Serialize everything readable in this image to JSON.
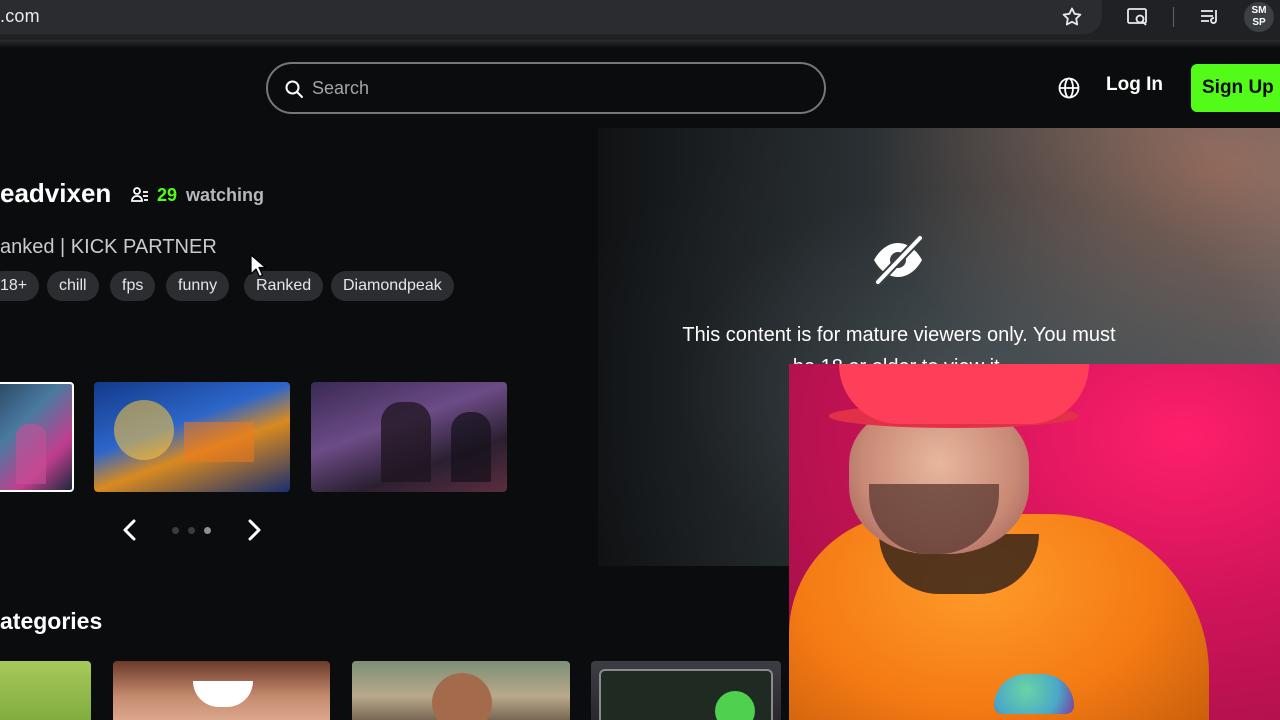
{
  "browser": {
    "url_fragment": ".com",
    "avatar_initials_top": "SM",
    "avatar_initials_bottom": "SP"
  },
  "header": {
    "search_placeholder": "Search",
    "login_label": "Log In",
    "signup_label": "Sign Up",
    "accent_color": "#53fc18"
  },
  "stream": {
    "channel_name": "eadvixen",
    "viewer_count": "29",
    "viewer_label": "watching",
    "title": "anked | KICK PARTNER",
    "tags": [
      "18+",
      "chill",
      "fps",
      "funny",
      "Ranked",
      "Diamondpeak"
    ]
  },
  "carousel": {
    "active_dot": 2,
    "dot_count": 3
  },
  "player": {
    "mature_line1": "This content is for mature viewers only. You must",
    "mature_line2": "be 18 or older to view it."
  },
  "categories": {
    "heading": "ategories"
  },
  "icons": {
    "search": "search-icon",
    "globe": "globe-icon",
    "star": "star-icon",
    "viewers": "viewers-icon",
    "mature": "eye-off-icon",
    "prev": "chevron-left-icon",
    "next": "chevron-right-icon"
  }
}
